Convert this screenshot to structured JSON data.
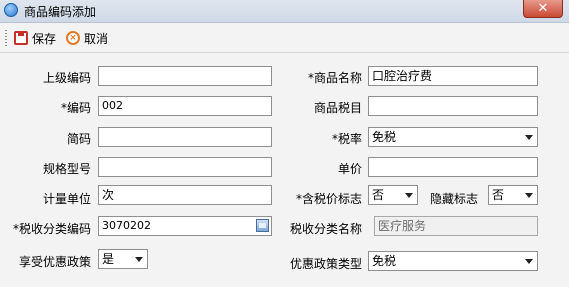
{
  "window": {
    "title": "商品编码添加"
  },
  "toolbar": {
    "save_label": "保存",
    "cancel_label": "取消"
  },
  "form": {
    "parent_code": {
      "label": "上级编码",
      "value": ""
    },
    "code": {
      "label": "*编码",
      "value": "002"
    },
    "short_code": {
      "label": "简码",
      "value": ""
    },
    "spec_model": {
      "label": "规格型号",
      "value": ""
    },
    "unit": {
      "label": "计量单位",
      "value": "次"
    },
    "tax_class_code": {
      "label": "*税收分类编码",
      "value": "3070202"
    },
    "enjoy_preferential": {
      "label": "享受优惠政策",
      "value": "是"
    },
    "product_name": {
      "label": "*商品名称",
      "value": "口腔治疗费"
    },
    "product_tax_item": {
      "label": "商品税目",
      "value": ""
    },
    "tax_rate": {
      "label": "*税率",
      "value": "免税"
    },
    "unit_price": {
      "label": "单价",
      "value": ""
    },
    "tax_included_flag": {
      "label": "*含税价标志",
      "value": "否"
    },
    "hidden_flag": {
      "label": "隐藏标志",
      "value": "否"
    },
    "tax_class_name": {
      "label": "税收分类名称",
      "value": "医疗服务"
    },
    "preferential_policy_type": {
      "label": "优惠政策类型",
      "value": "免税"
    }
  },
  "icons": [
    "app-icon",
    "close-icon",
    "save-icon",
    "cancel-icon",
    "chevron-down-icon",
    "picker-icon"
  ]
}
